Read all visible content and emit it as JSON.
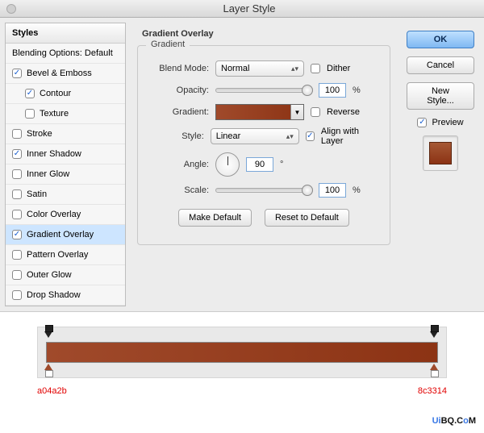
{
  "window": {
    "title": "Layer Style"
  },
  "styles": {
    "header": "Styles",
    "blending": {
      "label": "Blending Options: Default",
      "checked": false
    },
    "items": [
      {
        "label": "Bevel & Emboss",
        "checked": true
      },
      {
        "label": "Contour",
        "checked": true,
        "child": true
      },
      {
        "label": "Texture",
        "checked": false,
        "child": true
      },
      {
        "label": "Stroke",
        "checked": false
      },
      {
        "label": "Inner Shadow",
        "checked": true
      },
      {
        "label": "Inner Glow",
        "checked": false
      },
      {
        "label": "Satin",
        "checked": false
      },
      {
        "label": "Color Overlay",
        "checked": false
      },
      {
        "label": "Gradient Overlay",
        "checked": true,
        "selected": true
      },
      {
        "label": "Pattern Overlay",
        "checked": false
      },
      {
        "label": "Outer Glow",
        "checked": false
      },
      {
        "label": "Drop Shadow",
        "checked": false
      }
    ]
  },
  "panel": {
    "section_title": "Gradient Overlay",
    "group_title": "Gradient",
    "blend_mode": {
      "label": "Blend Mode:",
      "value": "Normal"
    },
    "dither": {
      "label": "Dither",
      "checked": false
    },
    "opacity": {
      "label": "Opacity:",
      "value": "100",
      "unit": "%"
    },
    "gradient": {
      "label": "Gradient:"
    },
    "reverse": {
      "label": "Reverse",
      "checked": false
    },
    "style": {
      "label": "Style:",
      "value": "Linear"
    },
    "align": {
      "label": "Align with Layer",
      "checked": true
    },
    "angle": {
      "label": "Angle:",
      "value": "90",
      "unit": "°"
    },
    "scale": {
      "label": "Scale:",
      "value": "100",
      "unit": "%"
    },
    "make_default": "Make Default",
    "reset_default": "Reset to Default"
  },
  "right": {
    "ok": "OK",
    "cancel": "Cancel",
    "new_style": "New Style...",
    "preview": {
      "label": "Preview",
      "checked": true
    }
  },
  "gradient_editor": {
    "left_hex": "a04a2b",
    "right_hex": "8c3314"
  },
  "watermark": "UiBQ.CoM"
}
